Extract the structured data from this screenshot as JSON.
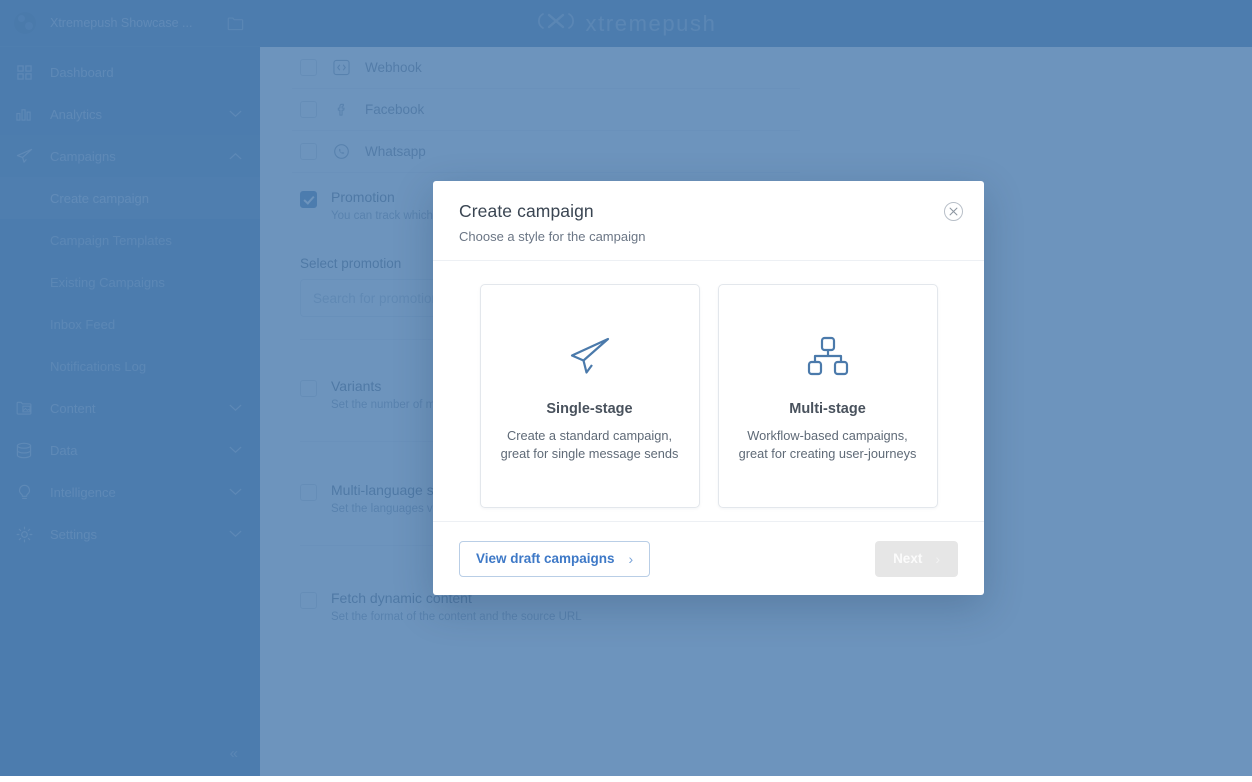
{
  "header": {
    "brand_text": "xtremepush",
    "brand_mark_icon": "xtremepush-logo-icon"
  },
  "sidebar": {
    "project_name": "Xtremepush Showcase ...",
    "project_logo_icon": "project-avatar-icon",
    "folder_icon": "folder-icon",
    "collapse_label": "«",
    "items": [
      {
        "label": "Dashboard",
        "icon": "grid-icon",
        "expandable": false,
        "expanded": false
      },
      {
        "label": "Analytics",
        "icon": "bar-chart-icon",
        "expandable": true,
        "expanded": false
      },
      {
        "label": "Campaigns",
        "icon": "paper-plane-icon",
        "expandable": true,
        "expanded": true
      },
      {
        "label": "Content",
        "icon": "media-folder-icon",
        "expandable": true,
        "expanded": false
      },
      {
        "label": "Data",
        "icon": "database-icon",
        "expandable": true,
        "expanded": false
      },
      {
        "label": "Intelligence",
        "icon": "lightbulb-icon",
        "expandable": true,
        "expanded": false
      },
      {
        "label": "Settings",
        "icon": "gear-icon",
        "expandable": true,
        "expanded": false
      }
    ],
    "campaign_subitems": [
      {
        "label": "Create campaign",
        "active": true
      },
      {
        "label": "Campaign Templates",
        "active": false
      },
      {
        "label": "Existing Campaigns",
        "active": false
      },
      {
        "label": "Inbox Feed",
        "active": false
      },
      {
        "label": "Notifications Log",
        "active": false
      }
    ]
  },
  "page": {
    "channels": [
      {
        "label": "Webhook",
        "icon": "code-brackets-icon",
        "checked": false
      },
      {
        "label": "Facebook",
        "icon": "facebook-icon",
        "checked": false
      },
      {
        "label": "Whatsapp",
        "icon": "whatsapp-icon",
        "checked": false
      }
    ],
    "sections": [
      {
        "title": "Promotion",
        "subtitle": "You can track which promotions were used",
        "checked": true
      },
      {
        "title": "Variants",
        "subtitle": "Set the number of message variants",
        "checked": false
      },
      {
        "title": "Multi-language support",
        "subtitle": "Set the languages variants",
        "checked": false
      },
      {
        "title": "Fetch dynamic content",
        "subtitle": "Set the format of the content and the source URL",
        "checked": false
      }
    ],
    "promotion_field_label": "Select promotion",
    "promotion_field_placeholder": "Search for promotions"
  },
  "modal": {
    "title": "Create campaign",
    "subtitle": "Choose a style for the campaign",
    "close_icon": "close-circle-icon",
    "options": [
      {
        "title": "Single-stage",
        "description": "Create a standard campaign, great for single message sends",
        "icon": "paper-plane-icon"
      },
      {
        "title": "Multi-stage",
        "description": "Workflow-based campaigns, great for creating user-journeys",
        "icon": "hierarchy-icon"
      }
    ],
    "secondary_button": "View draft campaigns",
    "secondary_button_arrow": "›",
    "primary_button": "Next",
    "primary_button_arrow": "›",
    "primary_button_disabled": true
  },
  "colors": {
    "brand_blue": "#4B7AAB",
    "overlay": "#5D81AE",
    "accent_link": "#3E79C7",
    "icon_blue": "#4B7AAB",
    "disabled_button_bg": "#E6E6E6"
  }
}
